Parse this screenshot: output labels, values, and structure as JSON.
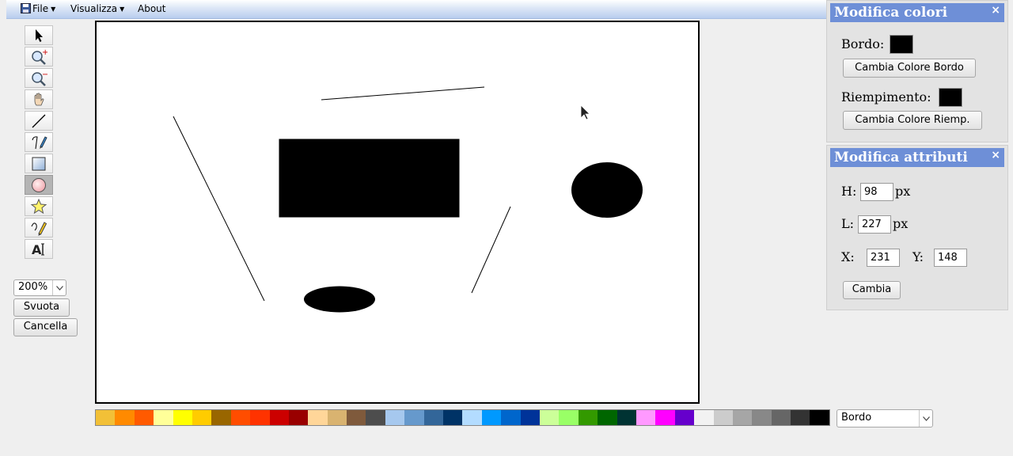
{
  "menubar": {
    "file": "File",
    "view": "Visualizza",
    "about": "About"
  },
  "tools": [
    {
      "name": "select-tool",
      "icon": "arrow-pointer-icon",
      "active": false
    },
    {
      "name": "zoom-in-tool",
      "icon": "zoom-in-icon",
      "active": false
    },
    {
      "name": "zoom-out-tool",
      "icon": "zoom-out-icon",
      "active": false
    },
    {
      "name": "pan-tool",
      "icon": "hand-icon",
      "active": false
    },
    {
      "name": "line-tool",
      "icon": "line-icon",
      "active": false
    },
    {
      "name": "path-tool",
      "icon": "pen-path-icon",
      "active": false
    },
    {
      "name": "rectangle-tool",
      "icon": "rectangle-icon",
      "active": false
    },
    {
      "name": "ellipse-tool",
      "icon": "ellipse-icon",
      "active": true
    },
    {
      "name": "star-tool",
      "icon": "star-icon",
      "active": false
    },
    {
      "name": "freehand-tool",
      "icon": "pencil-icon",
      "active": false
    },
    {
      "name": "text-tool",
      "icon": "text-icon",
      "active": false
    }
  ],
  "controls": {
    "zoom": "200%",
    "clear_label": "Svuota",
    "delete_label": "Cancella"
  },
  "palette": {
    "colors": [
      "#f2c037",
      "#ff8a00",
      "#ff5a00",
      "#ffff99",
      "#ffff00",
      "#ffcc00",
      "#996600",
      "#ff4d00",
      "#ff3300",
      "#cc0000",
      "#990000",
      "#ffd699",
      "#d9b370",
      "#7f5a3c",
      "#4d4d4d",
      "#a6c8ee",
      "#6699cc",
      "#336699",
      "#003366",
      "#b3dcff",
      "#0099ff",
      "#0066cc",
      "#003399",
      "#ccff99",
      "#99ff66",
      "#339900",
      "#006600",
      "#003333",
      "#ff99ff",
      "#ff00ff",
      "#6600cc",
      "#f2f2f2",
      "#cccccc",
      "#a6a6a6",
      "#888888",
      "#666666",
      "#333333",
      "#000000"
    ],
    "target": "Bordo"
  },
  "colors_panel": {
    "title": "Modifica colori",
    "close": "×",
    "border_label": "Bordo:",
    "border_color": "#000000",
    "change_border_label": "Cambia Colore Bordo",
    "fill_label": "Riempimento:",
    "fill_color": "#000000",
    "change_fill_label": "Cambia Colore Riemp."
  },
  "attributes_panel": {
    "title": "Modifica attributi",
    "close": "×",
    "h_label": "H:",
    "h_value": "98",
    "l_label": "L:",
    "l_value": "227",
    "px": "px",
    "x_label": "X:",
    "x_value": "231",
    "y_label": "Y:",
    "y_value": "148",
    "apply_label": "Cambia"
  }
}
